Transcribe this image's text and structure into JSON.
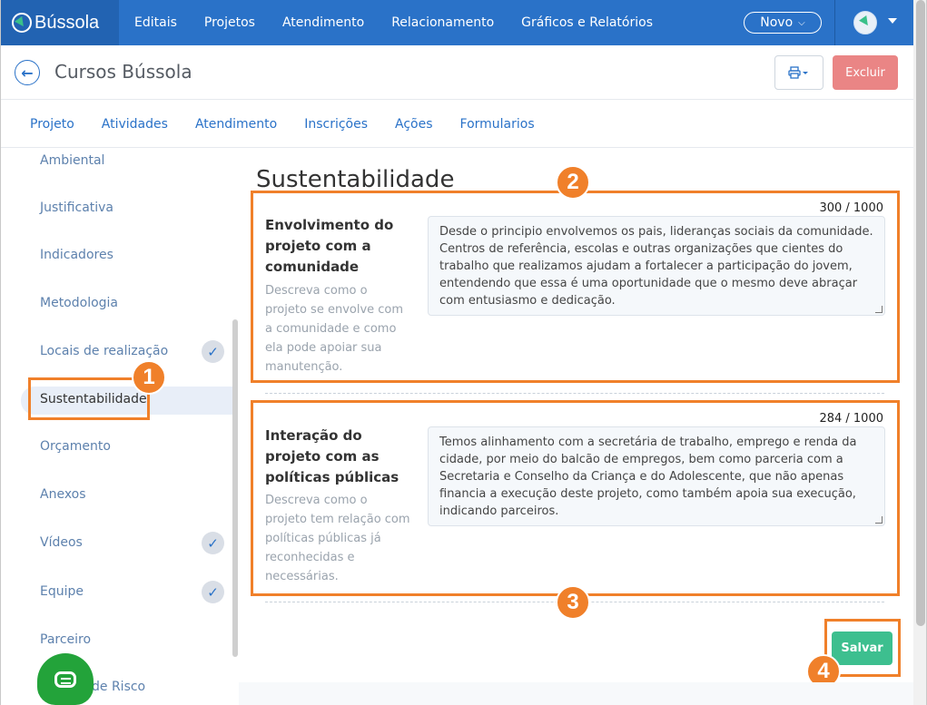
{
  "brand": {
    "name": "Bússola"
  },
  "topnav": [
    "Editais",
    "Projetos",
    "Atendimento",
    "Relacionamento",
    "Gráficos e Relatórios"
  ],
  "novo": {
    "label": "Novo",
    "chevron": "⌄"
  },
  "header": {
    "title": "Cursos Bússola",
    "back_icon": "arrow-left-icon",
    "print_icon": "printer-icon",
    "delete_label": "Excluir"
  },
  "tabs": [
    "Projeto",
    "Atividades",
    "Atendimento",
    "Inscrições",
    "Ações",
    "Formularios"
  ],
  "sidebar": {
    "items": [
      {
        "label": "Ambiental",
        "checked": false
      },
      {
        "label": "Justificativa",
        "checked": false
      },
      {
        "label": "Indicadores",
        "checked": false
      },
      {
        "label": "Metodologia",
        "checked": false
      },
      {
        "label": "Locais de realização",
        "checked": true
      },
      {
        "label": "Sustentabilidade",
        "checked": false,
        "active": true
      },
      {
        "label": "Orçamento",
        "checked": false
      },
      {
        "label": "Anexos",
        "checked": false
      },
      {
        "label": "Vídeos",
        "checked": true
      },
      {
        "label": "Equipe",
        "checked": true
      },
      {
        "label": "Parceiro",
        "checked": false
      },
      {
        "label": "de Risco",
        "checked": false
      }
    ],
    "check_glyph": "✓"
  },
  "main": {
    "section_title": "Sustentabilidade",
    "questions": [
      {
        "counter": "300 / 1000",
        "title": "Envolvimento do projeto com a comunidade",
        "description": "Descreva como o projeto se envolve com a comunidade e como ela pode apoiar sua manutenção.",
        "answer": "Desde o principio envolvemos os pais, lideranças sociais da comunidade. Centros de referência, escolas e outras organizações que cientes do trabalho que realizamos ajudam a fortalecer a participação do jovem, entendendo que essa é uma oportunidade que o mesmo deve abraçar com entusiasmo e dedicação."
      },
      {
        "counter": "284 / 1000",
        "title": "Interação do projeto com as políticas públicas",
        "description": "Descreva como o projeto tem relação com políticas públicas já reconhecidas e necessárias.",
        "answer": "Temos alinhamento com a secretária de trabalho, emprego e renda da cidade, por meio do balcão de empregos, bem como parceria com a Secretaria e Conselho da Criança e do Adolescente, que não apenas financia a execução deste projeto, como também apoia sua execução, indicando parceiros."
      }
    ],
    "save_label": "Salvar"
  },
  "annotations": [
    "1",
    "2",
    "3",
    "4"
  ],
  "colors": {
    "primary": "#2a72c8",
    "annotation": "#f0802a",
    "save": "#3dbf8f",
    "delete": "#ea8585",
    "chat": "#23a33a"
  }
}
